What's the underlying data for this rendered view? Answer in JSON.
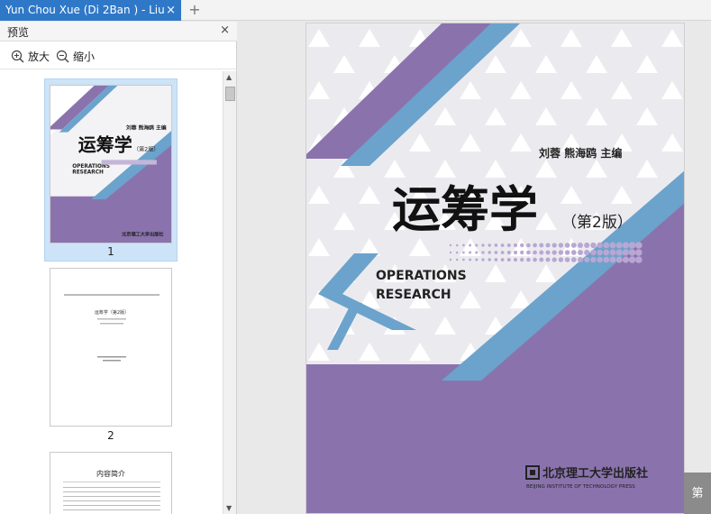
{
  "tabs": [
    {
      "title": "Yun Chou Xue (Di 2Ban ) - Liu",
      "close": "×"
    }
  ],
  "new_tab": "+",
  "sidebar": {
    "title": "预览",
    "close": "×",
    "zoom_in_label": "放大",
    "zoom_out_label": "缩小",
    "pages": [
      {
        "number": "1"
      },
      {
        "number": "2"
      }
    ],
    "page3_heading": "内容简介"
  },
  "cover": {
    "authors": "刘蓉    熊海鸥  主编",
    "title": "运筹学",
    "edition": "（第2版）",
    "en_title_1": "OPERATIONS",
    "en_title_2": "RESEARCH",
    "publisher": "北京理工大学出版社",
    "publisher_en": "BEIJING INSTITUTE OF TECHNOLOGY PRESS",
    "colors": {
      "purple": "#8a73ad",
      "blue": "#6ba3cc",
      "bg": "#f3f3f5"
    }
  },
  "page2_title": "运筹学（第2版）",
  "corner_label": "第"
}
